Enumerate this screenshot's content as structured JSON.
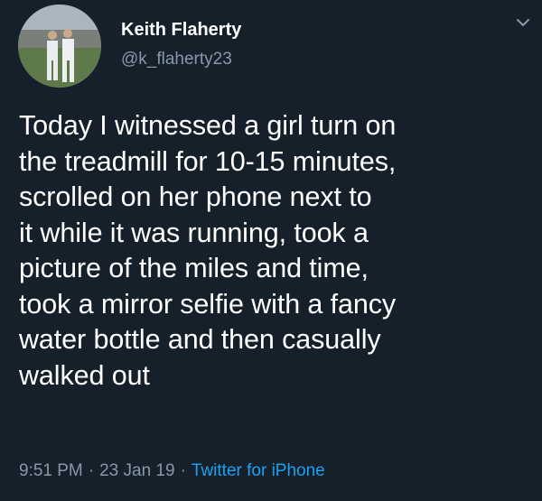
{
  "tweet": {
    "author": {
      "display_name": "Keith Flaherty",
      "handle": "@k_flaherty23",
      "avatar_icon": "profile-photo-two-baseball-players"
    },
    "menu_icon": "chevron-down-icon",
    "text": "Today I witnessed a girl turn on\nthe treadmill for 10-15 minutes,\nscrolled on her phone next to\nit while it was running, took a\npicture of the miles and time,\ntook a mirror selfie with a fancy\nwater bottle and then casually\nwalked out",
    "time": "9:51 PM",
    "separator": "·",
    "date": "23 Jan 19",
    "source": "Twitter for iPhone"
  },
  "colors": {
    "background": "#15202b",
    "primary_text": "#ffffff",
    "secondary_text": "#8899a6",
    "link": "#1da1f2"
  }
}
